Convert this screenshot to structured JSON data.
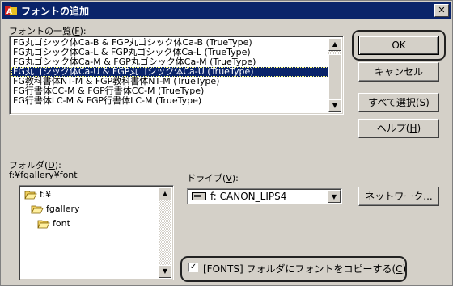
{
  "window": {
    "title": "フォントの追加",
    "close_glyph": "✕"
  },
  "font_list": {
    "label_prefix": "フォントの一覧(",
    "label_key": "F",
    "label_suffix": "):",
    "items": [
      "FG丸ゴシック体Ca-B & FGP丸ゴシック体Ca-B (TrueType)",
      "FG丸ゴシック体Ca-L & FGP丸ゴシック体Ca-L (TrueType)",
      "FG丸ゴシック体Ca-M & FGP丸ゴシック体Ca-M (TrueType)",
      "FG丸ゴシック体Ca-U & FGP丸ゴシック体Ca-U (TrueType)",
      "FG教科書体NT-M & FGP教科書体NT-M (TrueType)",
      "FG行書体CC-M & FGP行書体CC-M (TrueType)",
      "FG行書体LC-M & FGP行書体LC-M (TrueType)"
    ],
    "selected_index": 3
  },
  "buttons": {
    "ok": "OK",
    "cancel": "キャンセル",
    "select_all_prefix": "すべて選択(",
    "select_all_key": "S",
    "help_prefix": "ヘルプ(",
    "help_key": "H",
    "key_suffix": ")",
    "network": "ネットワーク..."
  },
  "folder": {
    "label_prefix": "フォルダ(",
    "label_key": "D",
    "label_suffix": "):",
    "current_path": "f:¥fgallery¥font",
    "tree": [
      {
        "name": "f:¥",
        "open": true
      },
      {
        "name": "fgallery",
        "open": true
      },
      {
        "name": "font",
        "open": true
      }
    ]
  },
  "drive": {
    "label_prefix": "ドライブ(",
    "label_key": "V",
    "label_suffix": "):",
    "selected": "f: CANON_LIPS4"
  },
  "copy_option": {
    "checked": true,
    "label_prefix": "[FONTS] フォルダにフォントをコピーする(",
    "label_key": "C",
    "label_suffix": ")"
  },
  "colors": {
    "title_bar": "#0a246a",
    "face": "#d4d0c8",
    "selection": "#0a246a"
  },
  "icons": {
    "title": "font-app-icon",
    "folder": "folder-icon",
    "drive": "drive-icon"
  }
}
